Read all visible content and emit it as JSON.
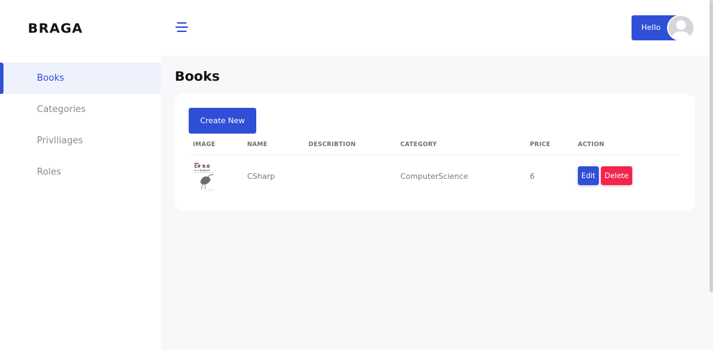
{
  "brand": {
    "logo_text": "BRAGA"
  },
  "sidebar": {
    "items": [
      {
        "label": "Books",
        "active": true
      },
      {
        "label": "Categories",
        "active": false
      },
      {
        "label": "Privlliages",
        "active": false
      },
      {
        "label": "Roles",
        "active": false
      }
    ]
  },
  "topbar": {
    "menu_icon": "hamburger-menu-icon",
    "user_greeting": "Hello",
    "avatar_icon": "user-avatar-icon"
  },
  "page": {
    "title": "Books"
  },
  "toolbar": {
    "create_label": "Create New"
  },
  "table": {
    "columns": [
      "IMAGE",
      "NAME",
      "DESCRIBTION",
      "CATEGORY",
      "PRICE",
      "ACTION"
    ],
    "rows": [
      {
        "image": {
          "icon": "book-cover-thumbnail",
          "cover_title": "C# 9.0",
          "cover_subtitle": "in a Nutshell"
        },
        "name": "CSharp",
        "description": "",
        "category": "ComputerScience",
        "price": "6",
        "actions": {
          "edit_label": "Edit",
          "delete_label": "Delete"
        }
      }
    ]
  },
  "colors": {
    "accent": "#2f4fd6",
    "danger": "#f0264f",
    "page_bg": "#f8f8fb",
    "active_nav_bg": "#eef2fc"
  }
}
